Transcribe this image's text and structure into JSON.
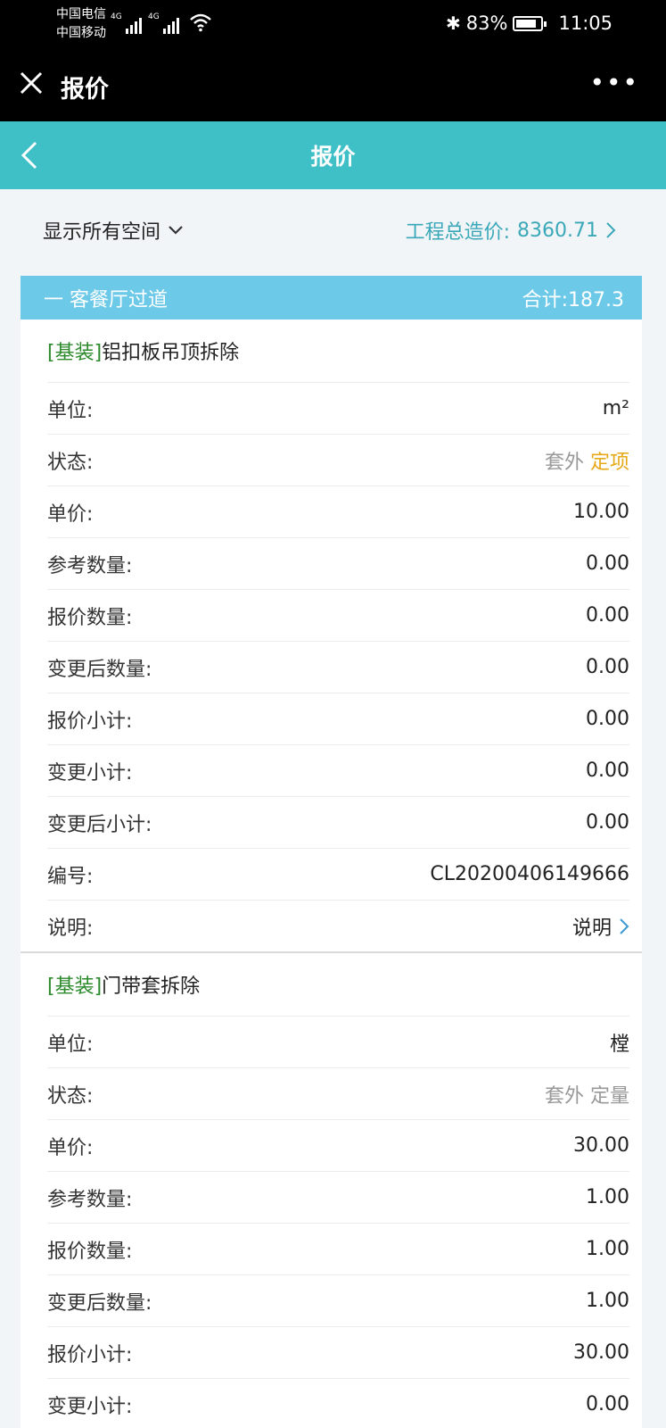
{
  "status_bar": {
    "carrier1": "中国电信",
    "carrier2": "中国移动",
    "net1": "4G",
    "net2": "4G",
    "battery": "83%",
    "time": "11:05"
  },
  "wechat_bar": {
    "title": "报价"
  },
  "header": {
    "title": "报价"
  },
  "filter": {
    "space_label": "显示所有空间",
    "total_label": "工程总造价:",
    "total_value": "8360.71"
  },
  "group": {
    "collapse": "一",
    "name": "客餐厅过道",
    "subtotal": "合计:187.3"
  },
  "items": [
    {
      "tag": "[基装]",
      "name": "铝扣板吊顶拆除",
      "rows": {
        "unit": {
          "label": "单位:",
          "value": "m²"
        },
        "status": {
          "label": "状态:",
          "value_a": "套外",
          "value_b": "定项"
        },
        "price": {
          "label": "单价:",
          "value": "10.00"
        },
        "ref_qty": {
          "label": "参考数量:",
          "value": "0.00"
        },
        "quote_qty": {
          "label": "报价数量:",
          "value": "0.00"
        },
        "changed_qty": {
          "label": "变更后数量:",
          "value": "0.00"
        },
        "quote_subtotal": {
          "label": "报价小计:",
          "value": "0.00"
        },
        "change_subtotal": {
          "label": "变更小计:",
          "value": "0.00"
        },
        "changed_subtotal": {
          "label": "变更后小计:",
          "value": "0.00"
        },
        "code": {
          "label": "编号:",
          "value": "CL20200406149666"
        },
        "note": {
          "label": "说明:",
          "value": "说明"
        }
      }
    },
    {
      "tag": "[基装]",
      "name": "门带套拆除",
      "rows": {
        "unit": {
          "label": "单位:",
          "value": "樘"
        },
        "status": {
          "label": "状态:",
          "value_a": "套外",
          "value_b": "定量"
        },
        "price": {
          "label": "单价:",
          "value": "30.00"
        },
        "ref_qty": {
          "label": "参考数量:",
          "value": "1.00"
        },
        "quote_qty": {
          "label": "报价数量:",
          "value": "1.00"
        },
        "changed_qty": {
          "label": "变更后数量:",
          "value": "1.00"
        },
        "quote_subtotal": {
          "label": "报价小计:",
          "value": "30.00"
        },
        "change_subtotal": {
          "label": "变更小计:",
          "value": "0.00"
        }
      }
    }
  ],
  "colors": {
    "header_teal": "#3fbfc6",
    "group_blue": "#6cc9e8",
    "total_teal": "#3aa8b8",
    "tag_green": "#2c8a2c",
    "status_orange": "#e6a817",
    "link_blue": "#3a9bd3"
  }
}
